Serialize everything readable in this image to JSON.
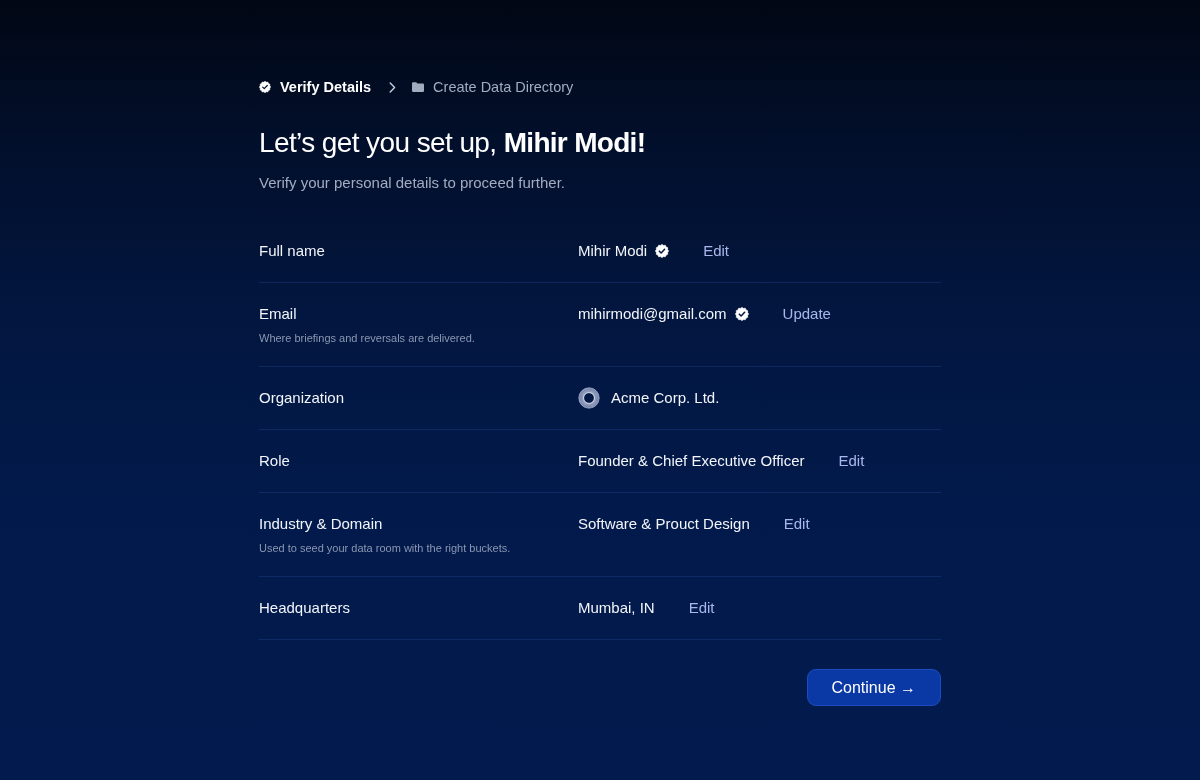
{
  "breadcrumb": [
    {
      "kind": "verification",
      "label": "Verify Details",
      "selected": true
    },
    {
      "kind": "directory",
      "label": "Create Data Directory",
      "selected": false
    }
  ],
  "heading": "Let’s get you set up, **Mihir Modi!**",
  "subtitle": "Verify your personal details to proceed further.",
  "fields": [
    {
      "kind": "text",
      "label": "Full name",
      "value": "Mihir Modi",
      "verified": true,
      "action": "Edit"
    },
    {
      "kind": "text",
      "label": "Email",
      "hint": "Where briefings and reversals are delivered.",
      "value": "mihirmodi@gmail.com",
      "verified": true,
      "action": "Update"
    },
    {
      "kind": "organization",
      "label": "Organization",
      "value": "Acme Corp. Ltd.",
      "verified": false
    },
    {
      "kind": "text",
      "label": "Role",
      "value": "Founder & Chief Executive Officer",
      "verified": false,
      "action": "Edit"
    },
    {
      "kind": "text",
      "label": "Industry & Domain",
      "hint": "Used to seed your data room with the right buckets.",
      "value": "Software & Prouct Design",
      "verified": false,
      "action": "Edit"
    },
    {
      "kind": "text",
      "label": "Headquarters",
      "value": "Mumbai, IN",
      "verified": false,
      "action": "Edit"
    }
  ],
  "continue_button": {
    "label": "Continue →"
  }
}
